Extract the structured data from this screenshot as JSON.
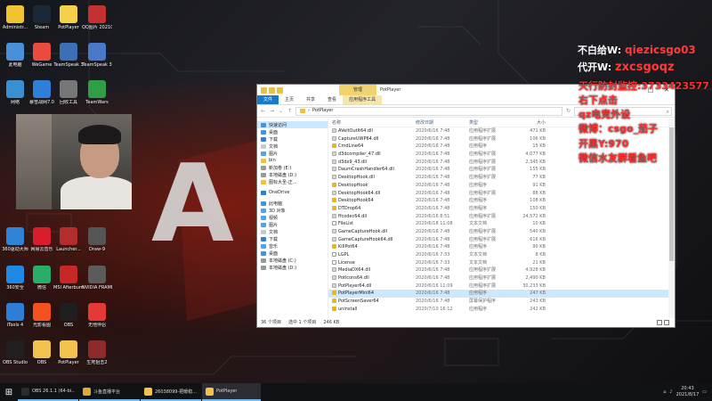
{
  "desktop": {
    "icons": [
      {
        "label": "Administr...",
        "color": "#f1c232"
      },
      {
        "label": "Steam",
        "color": "#1b2838"
      },
      {
        "label": "PotPlayer",
        "color": "#f5d04a"
      },
      {
        "label": "QQ图片 20210415...",
        "color": "#c53030"
      },
      {
        "label": "此电脑",
        "color": "#4a90d9"
      },
      {
        "label": "WeGame",
        "color": "#e94b3c"
      },
      {
        "label": "TeamSpeak 3",
        "color": "#3d6fb6"
      },
      {
        "label": "TeamSpeak 3",
        "color": "#4a79c7"
      },
      {
        "label": "网络",
        "color": "#3a8fd1"
      },
      {
        "label": "暴雪战网7.0",
        "color": "#2f7ed8"
      },
      {
        "label": "回收工具",
        "color": "#777777"
      },
      {
        "label": "TeamWars",
        "color": "#2f9e44"
      },
      {
        "label": "360驱动大师",
        "color": "#2f84d6"
      },
      {
        "label": "网易云音乐",
        "color": "#d81e2c"
      },
      {
        "label": "Launcher...",
        "color": "#b32d2d"
      },
      {
        "label": "Draw-9",
        "color": "#555555"
      },
      {
        "label": "360安全",
        "color": "#1e88e5"
      },
      {
        "label": "微信",
        "color": "#2aae67"
      },
      {
        "label": "MSI Afterburner",
        "color": "#c62828"
      },
      {
        "label": "NVIDIA FRAMEVIEW",
        "color": "#5b5b5b"
      },
      {
        "label": "iTools 4",
        "color": "#2e7dd7"
      },
      {
        "label": "光影看图",
        "color": "#f4511e"
      },
      {
        "label": "OBS",
        "color": "#1f1f1f"
      },
      {
        "label": "无他伴侣",
        "color": "#e53935"
      },
      {
        "label": "OBS Studio",
        "color": "#202020"
      },
      {
        "label": "OBS",
        "color": "#f2c14e"
      },
      {
        "label": "PotPlayer",
        "color": "#f2c14e"
      },
      {
        "label": "生死狙击2",
        "color": "#8e2a2a"
      }
    ]
  },
  "explorer": {
    "ribbon_tabs": [
      "文件",
      "主页",
      "共享",
      "查看",
      "应用程序工具"
    ],
    "manage_tab": "管理",
    "title": "PotPlayer",
    "path": "PotPlayer",
    "nav_items": [
      {
        "label": "快速访问",
        "color": "#4a90d9",
        "selected": true
      },
      {
        "label": "桌面",
        "color": "#4a90d9",
        "selected": false
      },
      {
        "label": "下载",
        "color": "#3a7bd5",
        "selected": false
      },
      {
        "label": "文档",
        "color": "#c9c9c9",
        "selected": false
      },
      {
        "label": "图片",
        "color": "#5aa0e6",
        "selected": false
      },
      {
        "label": "bin",
        "color": "#f0c040",
        "selected": false
      },
      {
        "label": "新加卷 (E:)",
        "color": "#999999",
        "selected": false
      },
      {
        "label": "本地磁盘 (D:)",
        "color": "#999999",
        "selected": false
      },
      {
        "label": "图标大圣-正...",
        "color": "#f0c040",
        "selected": false
      },
      {
        "label": "OneDrive",
        "color": "#2f7ed8",
        "selected": false
      },
      {
        "label": "此电脑",
        "color": "#4a90d9",
        "selected": false
      },
      {
        "label": "3D 对象",
        "color": "#5aa0e6",
        "selected": false
      },
      {
        "label": "视频",
        "color": "#5aa0e6",
        "selected": false
      },
      {
        "label": "图片",
        "color": "#5aa0e6",
        "selected": false
      },
      {
        "label": "文档",
        "color": "#c9c9c9",
        "selected": false
      },
      {
        "label": "下载",
        "color": "#3a7bd5",
        "selected": false
      },
      {
        "label": "音乐",
        "color": "#5aa0e6",
        "selected": false
      },
      {
        "label": "桌面",
        "color": "#4a90d9",
        "selected": false
      },
      {
        "label": "本地磁盘 (C:)",
        "color": "#999999",
        "selected": false
      },
      {
        "label": "本地磁盘 (D:)",
        "color": "#999999",
        "selected": false
      }
    ],
    "columns": {
      "name": "名称",
      "date": "修改日期",
      "type": "类型",
      "size": "大小"
    },
    "files": [
      {
        "name": "AVeltOutlt64.dll",
        "date": "2020/6/16 7:48",
        "type": "应用程序扩展",
        "size": "471 KB",
        "icon": "dll"
      },
      {
        "name": "CaptureUWP64.dll",
        "date": "2020/6/16 7:48",
        "type": "应用程序扩展",
        "size": "106 KB",
        "icon": "dll"
      },
      {
        "name": "CmdLine64",
        "date": "2020/6/16 7:48",
        "type": "应用程序",
        "size": "15 KB",
        "icon": "exe"
      },
      {
        "name": "d3dcompiler_47.dll",
        "date": "2020/6/16 7:48",
        "type": "应用程序扩展",
        "size": "4,077 KB",
        "icon": "dll"
      },
      {
        "name": "d3dx9_43.dll",
        "date": "2020/6/16 7:48",
        "type": "应用程序扩展",
        "size": "2,345 KB",
        "icon": "dll"
      },
      {
        "name": "DaumCrashHandler64.dll",
        "date": "2020/6/16 7:48",
        "type": "应用程序扩展",
        "size": "155 KB",
        "icon": "dll"
      },
      {
        "name": "DesktopHook.dll",
        "date": "2020/6/16 7:48",
        "type": "应用程序扩展",
        "size": "77 KB",
        "icon": "dll"
      },
      {
        "name": "DesktopHook",
        "date": "2020/6/16 7:48",
        "type": "应用程序",
        "size": "91 KB",
        "icon": "exe"
      },
      {
        "name": "DesktopHook64.dll",
        "date": "2020/6/16 7:48",
        "type": "应用程序扩展",
        "size": "88 KB",
        "icon": "dll"
      },
      {
        "name": "DesktopHook64",
        "date": "2020/6/16 7:48",
        "type": "应用程序",
        "size": "108 KB",
        "icon": "exe"
      },
      {
        "name": "DTDrop64",
        "date": "2020/6/16 7:48",
        "type": "应用程序",
        "size": "150 KB",
        "icon": "exe"
      },
      {
        "name": "ffcodec64.dll",
        "date": "2020/6/16 8:51",
        "type": "应用程序扩展",
        "size": "24,572 KB",
        "icon": "dll"
      },
      {
        "name": "FileList",
        "date": "2020/6/18 11:08",
        "type": "文本文档",
        "size": "10 KB",
        "icon": "txt"
      },
      {
        "name": "GameCaptureHook.dll",
        "date": "2020/6/16 7:48",
        "type": "应用程序扩展",
        "size": "540 KB",
        "icon": "dll"
      },
      {
        "name": "GameCaptureHook64.dll",
        "date": "2020/6/16 7:48",
        "type": "应用程序扩展",
        "size": "616 KB",
        "icon": "dll"
      },
      {
        "name": "KillPot64",
        "date": "2020/6/16 7:48",
        "type": "应用程序",
        "size": "90 KB",
        "icon": "exe"
      },
      {
        "name": "LGPL",
        "date": "2020/6/16 7:33",
        "type": "文本文档",
        "size": "8 KB",
        "icon": "txt"
      },
      {
        "name": "License",
        "date": "2020/6/16 7:33",
        "type": "文本文档",
        "size": "21 KB",
        "icon": "txt"
      },
      {
        "name": "MediaDX64.dll",
        "date": "2020/6/16 7:48",
        "type": "应用程序扩展",
        "size": "4,928 KB",
        "icon": "dll"
      },
      {
        "name": "Potlcons64.dll",
        "date": "2020/6/16 7:48",
        "type": "应用程序扩展",
        "size": "2,490 KB",
        "icon": "dll"
      },
      {
        "name": "PotPlayer64.dll",
        "date": "2020/6/16 11:09",
        "type": "应用程序扩展",
        "size": "30,233 KB",
        "icon": "dll"
      },
      {
        "name": "PotPlayerMini64",
        "date": "2020/6/16 7:48",
        "type": "应用程序",
        "size": "247 KB",
        "icon": "exe",
        "selected": true
      },
      {
        "name": "PotScreenSaver64",
        "date": "2020/6/16 7:48",
        "type": "屏幕保护程序",
        "size": "243 KB",
        "icon": "exe"
      },
      {
        "name": "uninstall",
        "date": "2020/7/10 16:12",
        "type": "应用程序",
        "size": "242 KB",
        "icon": "exe"
      }
    ],
    "status": {
      "count": "36 个项目",
      "selected": "选中 1 个项目",
      "size": "246 KB"
    }
  },
  "overlay": {
    "line1_label": "不白给W:",
    "line1_value": "qiezicsgo03",
    "line2_label": "代开W:",
    "line2_value": "zxcsgoqz",
    "lines": [
      "天行防封监控:3733423577",
      "右下点击",
      "qz电竞外设",
      "微博：csgo_茄子",
      "开黑Y:970",
      "微信水友群看鱼吧"
    ]
  },
  "taskbar": {
    "items": [
      {
        "label": "OBS 26.1.1 (64-bi...",
        "color": "#2c2c2c",
        "active": false
      },
      {
        "label": "斗鱼直播平台",
        "color": "#e0a93b",
        "active": false
      },
      {
        "label": "26038099-把暖稳...",
        "color": "#f2c14e",
        "active": false
      },
      {
        "label": "PotPlayer",
        "color": "#f2c14e",
        "active": true
      }
    ],
    "time": "20:43",
    "date": "2021/8/17"
  }
}
